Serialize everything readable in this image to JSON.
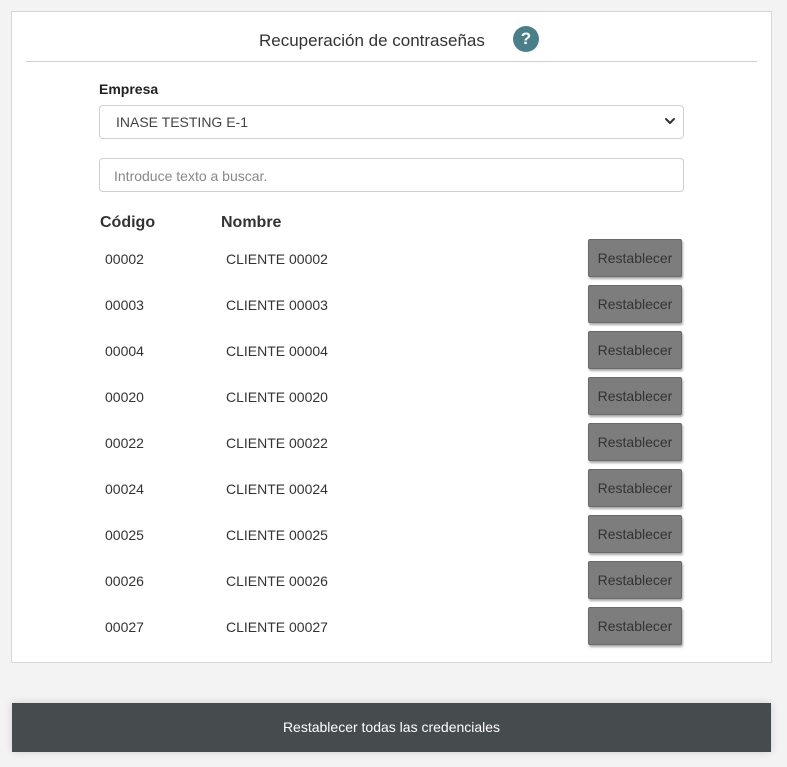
{
  "header": {
    "title": "Recuperación de contraseñas",
    "help_symbol": "?"
  },
  "form": {
    "empresa_label": "Empresa",
    "empresa_selected": "INASE TESTING E-1",
    "search_placeholder": "Introduce texto a buscar."
  },
  "table": {
    "columns": [
      "Código",
      "Nombre"
    ],
    "rows": [
      {
        "code": "00002",
        "name": "CLIENTE 00002",
        "action": "Restablecer"
      },
      {
        "code": "00003",
        "name": "CLIENTE 00003",
        "action": "Restablecer"
      },
      {
        "code": "00004",
        "name": "CLIENTE 00004",
        "action": "Restablecer"
      },
      {
        "code": "00020",
        "name": "CLIENTE 00020",
        "action": "Restablecer"
      },
      {
        "code": "00022",
        "name": "CLIENTE 00022",
        "action": "Restablecer"
      },
      {
        "code": "00024",
        "name": "CLIENTE 00024",
        "action": "Restablecer"
      },
      {
        "code": "00025",
        "name": "CLIENTE 00025",
        "action": "Restablecer"
      },
      {
        "code": "00026",
        "name": "CLIENTE 00026",
        "action": "Restablecer"
      },
      {
        "code": "00027",
        "name": "CLIENTE 00027",
        "action": "Restablecer"
      }
    ]
  },
  "footer": {
    "reset_all_label": "Restablecer todas las credenciales"
  },
  "icons": {
    "help": "help-icon",
    "select_arrow": "chevron-down-icon"
  },
  "colors": {
    "help_bg": "#4a7f89",
    "reset_button_bg": "#7d7d7d",
    "bottom_bar_bg": "#464b4d"
  }
}
